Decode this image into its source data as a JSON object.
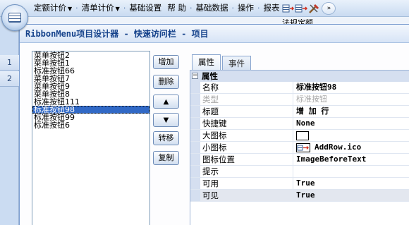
{
  "menubar": {
    "items": [
      "定额计价",
      "清单计价",
      "基础设置",
      "帮 助",
      "基础数据",
      "操作",
      "报表"
    ],
    "qat_icons": [
      "insert-row-icon",
      "add-row-icon",
      "tools-icon",
      "customize-dropdown-icon"
    ]
  },
  "background": {
    "row_numbers": [
      "1",
      "2"
    ],
    "peek_text": "法规定额"
  },
  "dialog": {
    "title": "RibbonMenu项目设计器 - 快速访问栏 - 项目",
    "items": [
      "菜单按钮2",
      "菜单按钮1",
      "标准按钮66",
      "菜单按钮7",
      "菜单按钮9",
      "菜单按钮8",
      "标准按钮111",
      "标准按钮98",
      "标准按钮99",
      "标准按钮6"
    ],
    "selected_item": "标准按钮98",
    "buttons": {
      "add": "增加",
      "delete": "删除",
      "up": "▲",
      "down": "▼",
      "move": "转移",
      "copy": "复制"
    },
    "tabs": [
      "属性",
      "事件"
    ],
    "active_tab": "属性",
    "properties": {
      "category": "属性",
      "rows": [
        {
          "name": "名称",
          "value": "标准按钮98"
        },
        {
          "name": "类型",
          "value": "标准按钮"
        },
        {
          "name": "标题",
          "value": "增 加 行"
        },
        {
          "name": "快捷键",
          "value": "None"
        },
        {
          "name": "大图标",
          "value": ""
        },
        {
          "name": "小图标",
          "value": "AddRow.ico"
        },
        {
          "name": "图标位置",
          "value": "ImageBeforeText"
        },
        {
          "name": "提示",
          "value": ""
        },
        {
          "name": "可用",
          "value": "True"
        },
        {
          "name": "可见",
          "value": "True"
        }
      ]
    }
  },
  "colors": {
    "selection": "#3169c6",
    "title_text": "#15428b",
    "category_bg": "#d5dff0"
  }
}
